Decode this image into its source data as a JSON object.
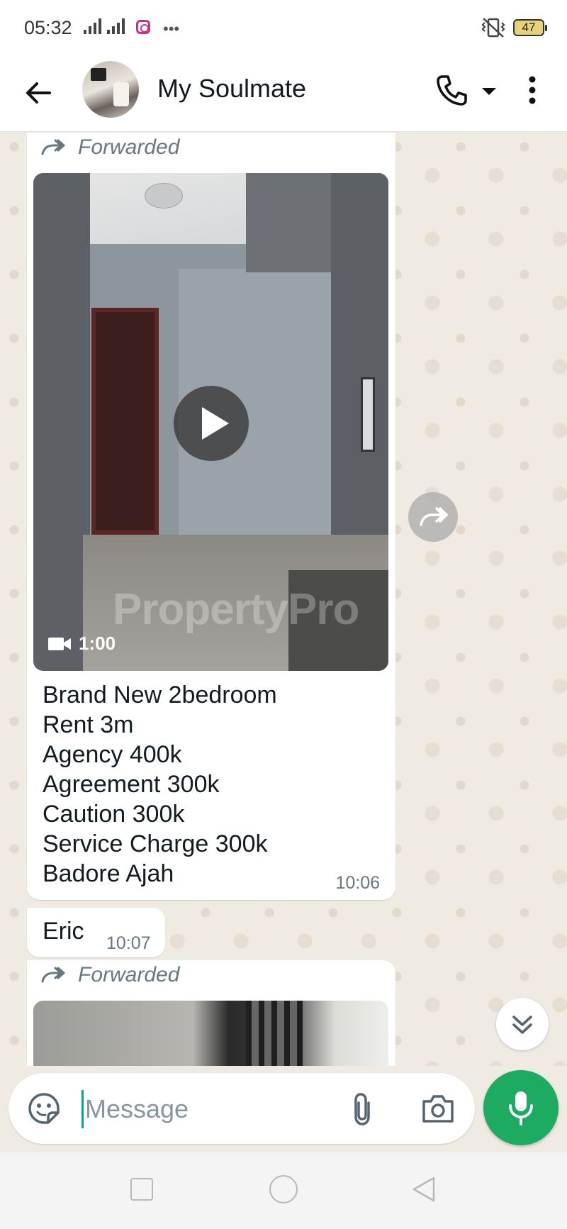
{
  "status_bar": {
    "time": "05:32",
    "battery": "47",
    "icons": [
      "hd-signal-icon",
      "signal-icon",
      "instagram-icon",
      "more-dots-icon",
      "vibrate-icon",
      "battery-icon"
    ]
  },
  "header": {
    "contact_name": "My Soulmate",
    "icons": [
      "back-arrow-icon",
      "avatar",
      "phone-icon",
      "dropdown-arrow-icon",
      "more-vert-icon"
    ]
  },
  "messages": [
    {
      "forwarded_label": "Forwarded",
      "video_duration": "1:00",
      "watermark": "PropertyPro",
      "caption_lines": [
        "Brand New 2bedroom",
        "Rent 3m",
        "Agency 400k",
        "Agreement 300k",
        "Caution 300k",
        "Service Charge 300k",
        "Badore Ajah"
      ],
      "time": "10:06"
    },
    {
      "text": "Eric",
      "time": "10:07"
    },
    {
      "forwarded_label": "Forwarded"
    }
  ],
  "input": {
    "placeholder": "Message",
    "value": ""
  },
  "colors": {
    "accent_green": "#1daa61",
    "chat_background": "#efeae2",
    "bubble": "#ffffff",
    "caret": "#00a884"
  }
}
